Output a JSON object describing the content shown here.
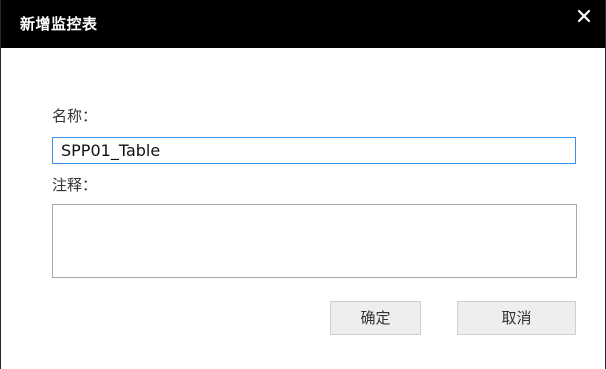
{
  "dialog": {
    "title": "新增监控表",
    "close_symbol": "×",
    "close_icon": "close-icon"
  },
  "form": {
    "name_label": "名称：",
    "name_value": "SPP01_Table",
    "note_label": "注释：",
    "note_value": ""
  },
  "buttons": {
    "ok_label": "确定",
    "cancel_label": "取消"
  },
  "colors": {
    "titlebar": "#000000",
    "focus_border": "#3a8ee6",
    "button_bg": "#eeeeee"
  }
}
